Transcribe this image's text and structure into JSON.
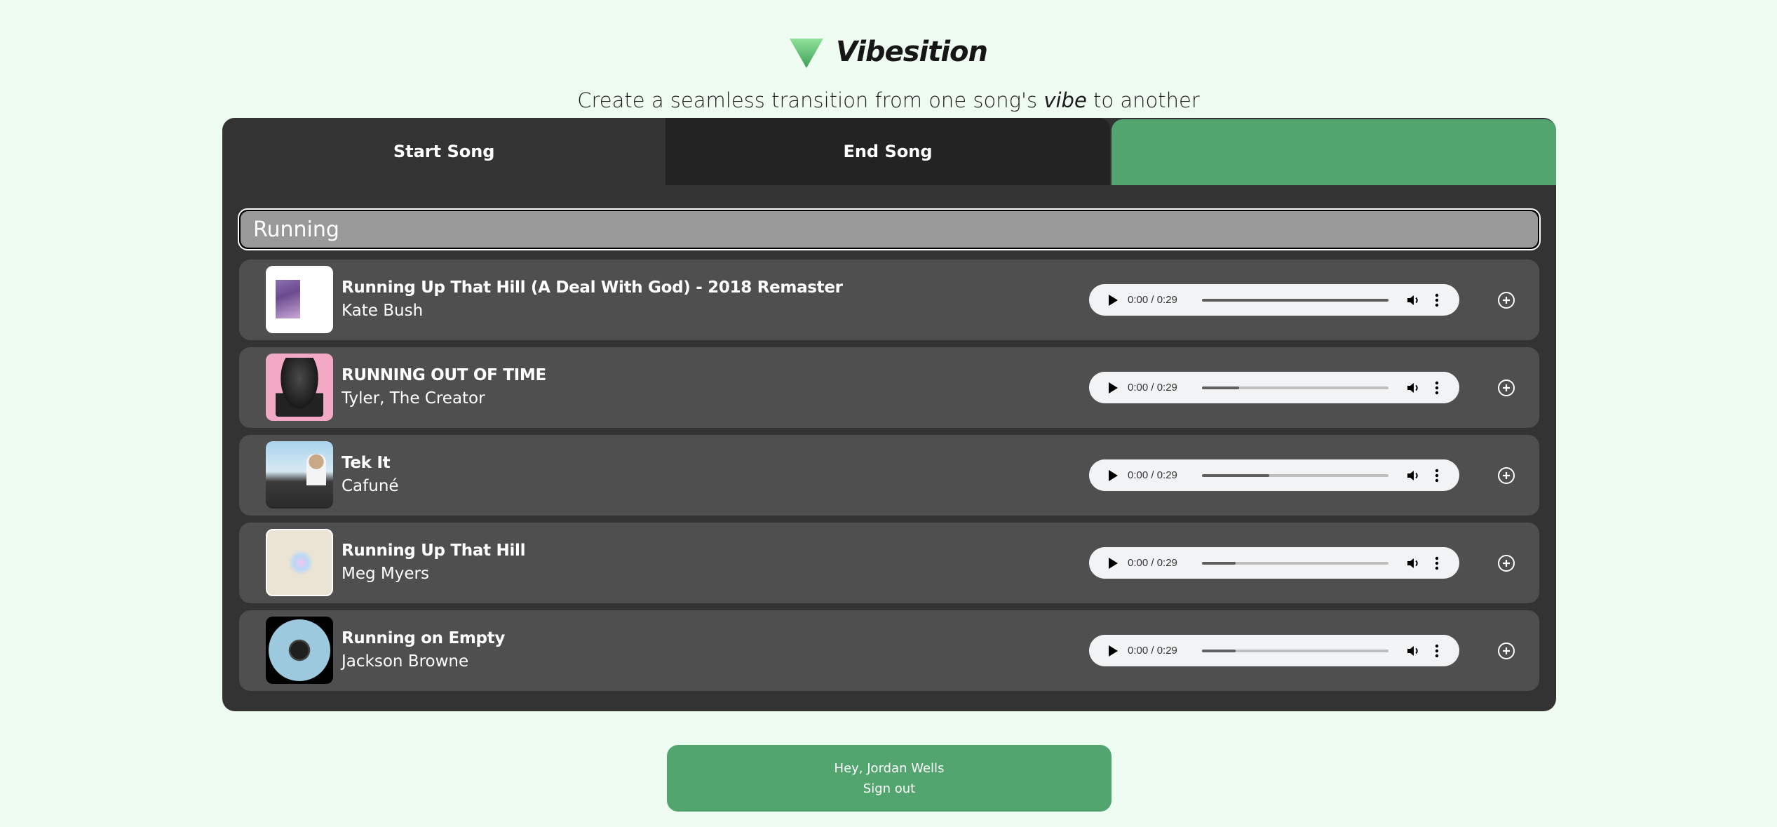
{
  "app": {
    "name": "Vibesition",
    "tagline_before": "Create a seamless transition from one song's ",
    "tagline_emphasis": "vibe",
    "tagline_after": " to another",
    "accent_color": "#52a56f"
  },
  "tabs": [
    {
      "label": "Start Song",
      "active": true
    },
    {
      "label": "End Song",
      "active": false
    },
    {
      "label": "",
      "active": false
    }
  ],
  "search": {
    "value": "Running",
    "placeholder": ""
  },
  "results": [
    {
      "title": "Running Up That Hill (A Deal With God) - 2018 Remaster",
      "artist": "Kate Bush",
      "time": "0:00 / 0:29",
      "buffered_percent": 100,
      "art_icon": "album-art-kate-bush"
    },
    {
      "title": "RUNNING OUT OF TIME",
      "artist": "Tyler, The Creator",
      "time": "0:00 / 0:29",
      "buffered_percent": 20,
      "art_icon": "album-art-tyler-the-creator"
    },
    {
      "title": "Tek It",
      "artist": "Cafuné",
      "time": "0:00 / 0:29",
      "buffered_percent": 36,
      "art_icon": "album-art-cafune"
    },
    {
      "title": "Running Up That Hill",
      "artist": "Meg Myers",
      "time": "0:00 / 0:29",
      "buffered_percent": 18,
      "art_icon": "album-art-meg-myers"
    },
    {
      "title": "Running on Empty",
      "artist": "Jackson Browne",
      "time": "0:00 / 0:29",
      "buffered_percent": 18,
      "art_icon": "album-art-jackson-browne"
    }
  ],
  "footer": {
    "greeting": "Hey, Jordan Wells",
    "signout_label": "Sign out"
  }
}
